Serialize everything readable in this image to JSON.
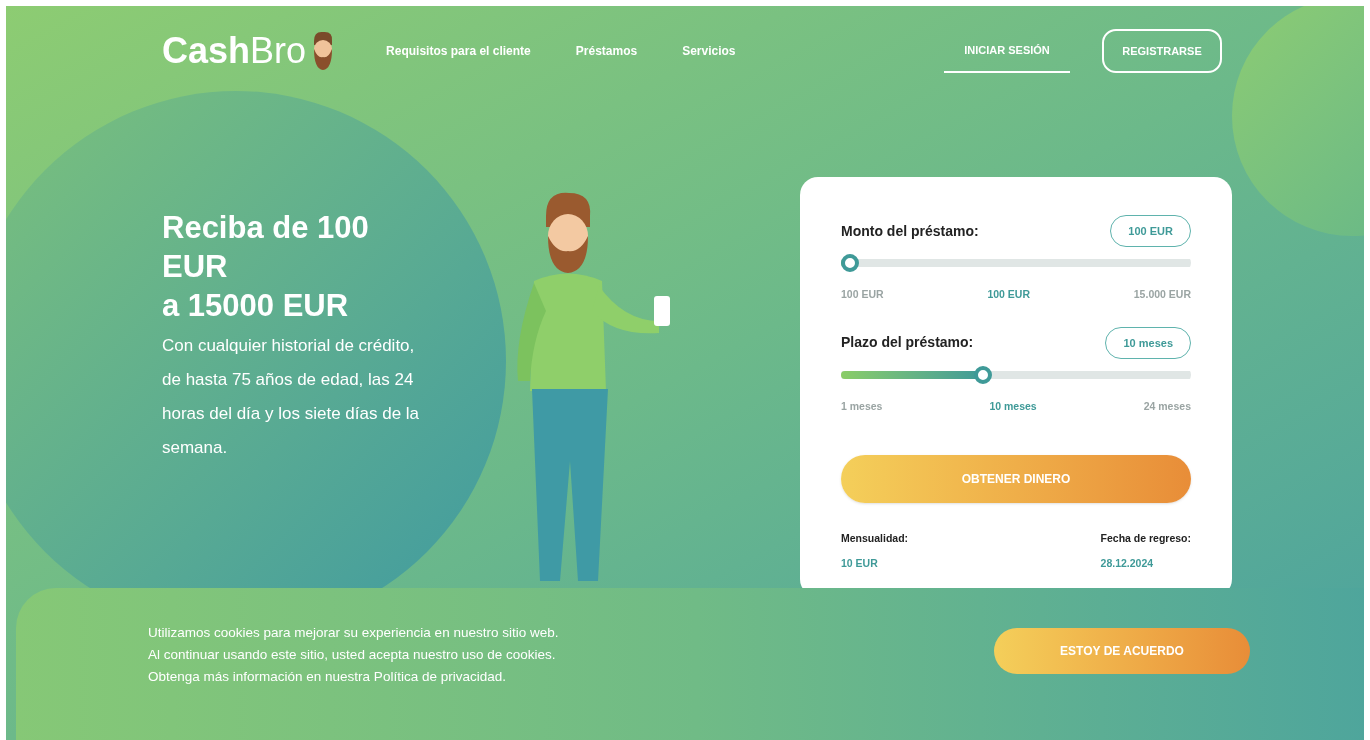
{
  "header": {
    "logo": "**Cash**Bro",
    "nav": [
      {
        "label": "Requisitos para el cliente"
      },
      {
        "label": "Préstamos"
      },
      {
        "label": "Servicios"
      }
    ],
    "login": {
      "label": "INICIAR SESIÓN",
      "selected": true
    },
    "register": {
      "label": "REGISTRARSE"
    }
  },
  "hero": {
    "title_lines": [
      "Reciba de 100 EUR",
      "a 15000 EUR"
    ],
    "subtitle": "Con cualquier historial de crédito, de hasta 75 años de edad, las 24 horas del día y los siete días de la semana."
  },
  "calculator": {
    "sliders": [
      {
        "label": "Monto del préstamo:",
        "value": "100 EUR",
        "level": 0,
        "min": "100 EUR",
        "current": "100 EUR",
        "max": "15.000 EUR"
      },
      {
        "label": "Plazo del préstamo:",
        "value": "10 meses",
        "level": 0.39,
        "min": "1 meses",
        "current": "10 meses",
        "max": "24 meses"
      }
    ],
    "submit": "OBTENER DINERO",
    "results": [
      {
        "label": "Mensualidad:",
        "value": "10 EUR"
      },
      {
        "label": "Fecha de regreso:",
        "value": "28.12.2024"
      }
    ]
  },
  "cookie_banner": {
    "text": "Utilizamos cookies para mejorar su experiencia en nuestro sitio web. Al continuar usando este sitio, usted acepta nuestro uso de cookies. Obtenga más información en nuestra Política de privacidad.",
    "button": "ESTOY DE ACUERDO"
  }
}
